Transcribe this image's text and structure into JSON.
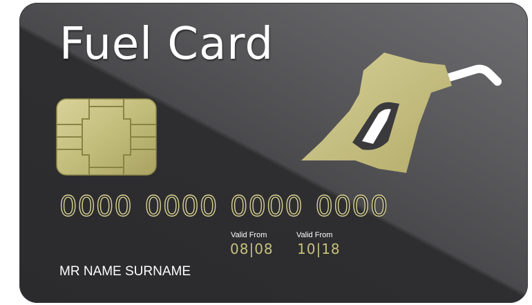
{
  "card": {
    "title": "Fuel Card",
    "number": "0000 0000 0000 0000",
    "valid_from_label_1": "Valid From",
    "valid_from_value_1": "08|08",
    "valid_from_label_2": "Valid From",
    "valid_from_value_2": "10|18",
    "holder_name": "MR NAME SURNAME"
  },
  "colors": {
    "card_background": "#2e2e30",
    "accent_gold": "#c7c17f",
    "text_white": "#ffffff"
  },
  "icons": {
    "chip": "chip-icon",
    "fuel_nozzle": "fuel-nozzle-icon"
  }
}
